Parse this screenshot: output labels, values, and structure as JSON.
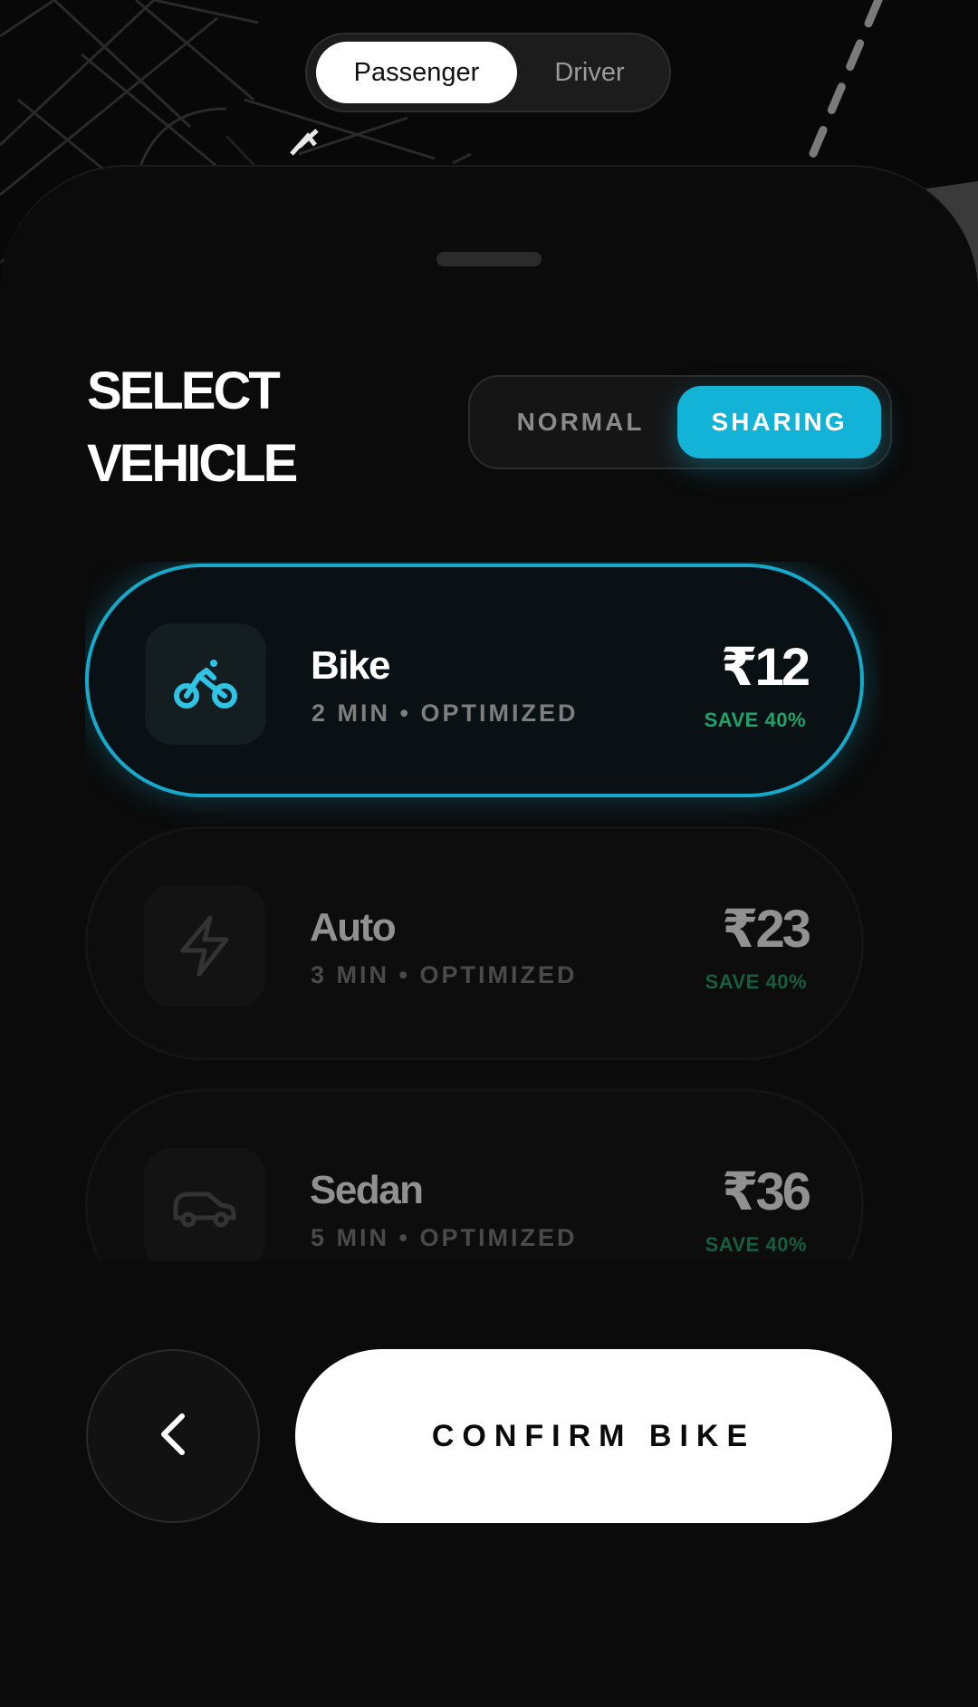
{
  "role_toggle": {
    "options": [
      "Passenger",
      "Driver"
    ],
    "selected": "Passenger"
  },
  "sheet": {
    "title_line1": "SELECT",
    "title_line2": "VEHICLE",
    "mode_toggle": {
      "options": [
        "NORMAL",
        "SHARING"
      ],
      "selected": "SHARING"
    },
    "vehicles": [
      {
        "name": "Bike",
        "meta": "2 MIN • OPTIMIZED",
        "price": "₹12",
        "save": "SAVE 40%",
        "icon": "bicycle-icon",
        "selected": true
      },
      {
        "name": "Auto",
        "meta": "3 MIN • OPTIMIZED",
        "price": "₹23",
        "save": "SAVE 40%",
        "icon": "lightning-icon",
        "selected": false
      },
      {
        "name": "Sedan",
        "meta": "5 MIN • OPTIMIZED",
        "price": "₹36",
        "save": "SAVE 40%",
        "icon": "car-icon",
        "selected": false
      }
    ]
  },
  "actions": {
    "back_icon": "chevron-left-icon",
    "confirm_label": "CONFIRM BIKE"
  },
  "colors": {
    "accent": "#12b3d6",
    "save_green": "#1fa36a",
    "background": "#080808"
  }
}
